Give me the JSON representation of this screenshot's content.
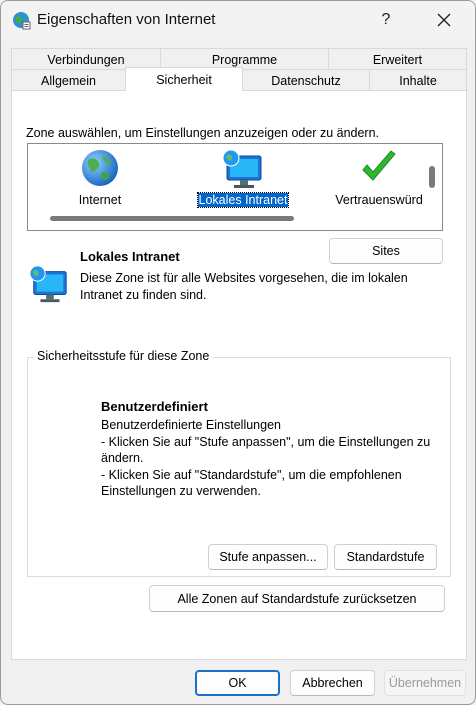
{
  "window": {
    "title": "Eigenschaften von Internet",
    "help_label": "?",
    "close_label": "✕"
  },
  "tabs": {
    "row1": [
      "Verbindungen",
      "Programme",
      "Erweitert"
    ],
    "row2": [
      "Allgemein",
      "Sicherheit",
      "Datenschutz",
      "Inhalte"
    ],
    "active": "Sicherheit"
  },
  "security": {
    "zone_prompt": "Zone auswählen, um Einstellungen anzuzeigen oder zu ändern.",
    "zones": [
      {
        "label": "Internet",
        "icon": "globe-icon",
        "selected": false
      },
      {
        "label": "Lokales Intranet",
        "icon": "intranet-monitor-icon",
        "selected": true
      },
      {
        "label": "Vertrauenswürd",
        "icon": "checkmark-icon",
        "selected": false
      }
    ],
    "selected_zone": {
      "title": "Lokales Intranet",
      "description": "Diese Zone ist für alle Websites vorgesehen, die im lokalen Intranet zu finden sind.",
      "sites_button": "Sites"
    },
    "level_group": {
      "legend": "Sicherheitsstufe für diese Zone",
      "level_title": "Benutzerdefiniert",
      "lines": [
        "Benutzerdefinierte Einstellungen",
        "- Klicken Sie auf \"Stufe anpassen\", um die Einstellungen zu ändern.",
        "- Klicken Sie auf \"Standardstufe\", um die empfohlenen Einstellungen zu verwenden."
      ],
      "custom_button": "Stufe anpassen...",
      "default_button": "Standardstufe"
    },
    "reset_all_button": "Alle Zonen auf Standardstufe zurücksetzen"
  },
  "footer": {
    "ok": "OK",
    "cancel": "Abbrechen",
    "apply": "Übernehmen"
  },
  "colors": {
    "selection": "#0066cc",
    "focus_border": "#1a6fc9",
    "check_green": "#2fb82f"
  }
}
